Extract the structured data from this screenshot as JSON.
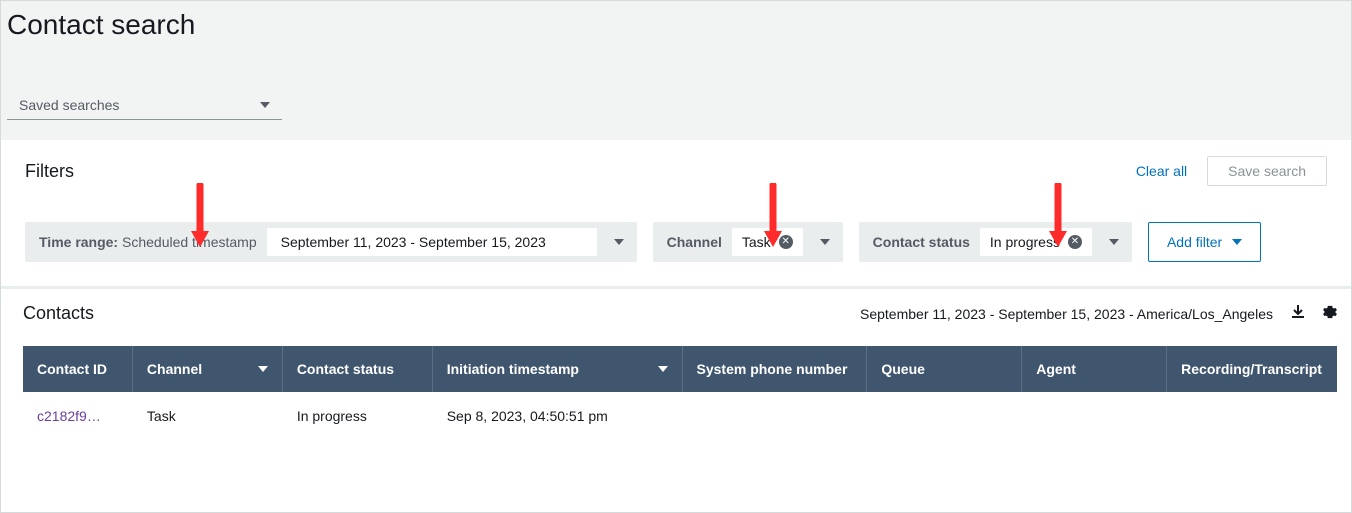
{
  "header": {
    "title": "Contact search",
    "saved_searches_label": "Saved searches"
  },
  "filters": {
    "title": "Filters",
    "clear_all": "Clear all",
    "save_search": "Save search",
    "time_range": {
      "label": "Time range:",
      "sublabel": "Scheduled timestamp",
      "value": "September 11, 2023 - September 15, 2023"
    },
    "channel": {
      "label": "Channel",
      "value": "Task"
    },
    "contact_status": {
      "label": "Contact status",
      "value": "In progress"
    },
    "add_filter": "Add filter"
  },
  "contacts": {
    "title": "Contacts",
    "summary": "September 11, 2023 - September 15, 2023 - America/Los_Angeles",
    "columns": {
      "contact_id": "Contact ID",
      "channel": "Channel",
      "contact_status": "Contact status",
      "initiation_timestamp": "Initiation timestamp",
      "system_phone": "System phone number",
      "queue": "Queue",
      "agent": "Agent",
      "recording": "Recording/Transcript"
    },
    "rows": [
      {
        "contact_id": "c2182f9…",
        "channel": "Task",
        "contact_status": "In progress",
        "initiation_timestamp": "Sep 8, 2023, 04:50:51 pm",
        "system_phone": "",
        "queue": "",
        "agent": "",
        "recording": ""
      }
    ]
  }
}
